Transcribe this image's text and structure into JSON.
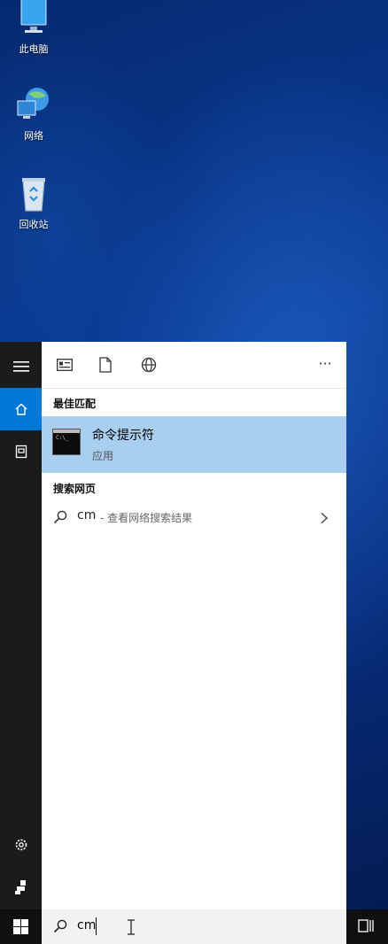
{
  "desktop": {
    "icons": [
      {
        "label": "此电脑",
        "icon": "this-pc-icon"
      },
      {
        "label": "网络",
        "icon": "network-icon"
      },
      {
        "label": "回收站",
        "icon": "recycle-bin-icon"
      }
    ]
  },
  "start_menu": {
    "rail": [
      "hamburger-icon",
      "home-icon",
      "documents-icon",
      "settings-icon",
      "user-icon"
    ],
    "toolbar": [
      "apps-filter-icon",
      "document-filter-icon",
      "web-filter-icon",
      "more-icon"
    ],
    "more_label": "···",
    "best_match": {
      "heading": "最佳匹配",
      "title": "命令提示符",
      "subtitle": "应用",
      "icon_text": "C:\\_"
    },
    "search_web": {
      "heading": "搜索网页",
      "query": "cm",
      "hint": "- 查看网络搜索结果"
    }
  },
  "taskbar": {
    "search_value": "cm"
  },
  "colors": {
    "accent": "#0078d7",
    "selection": "#a9cff0",
    "rail": "#1b1b1b"
  }
}
